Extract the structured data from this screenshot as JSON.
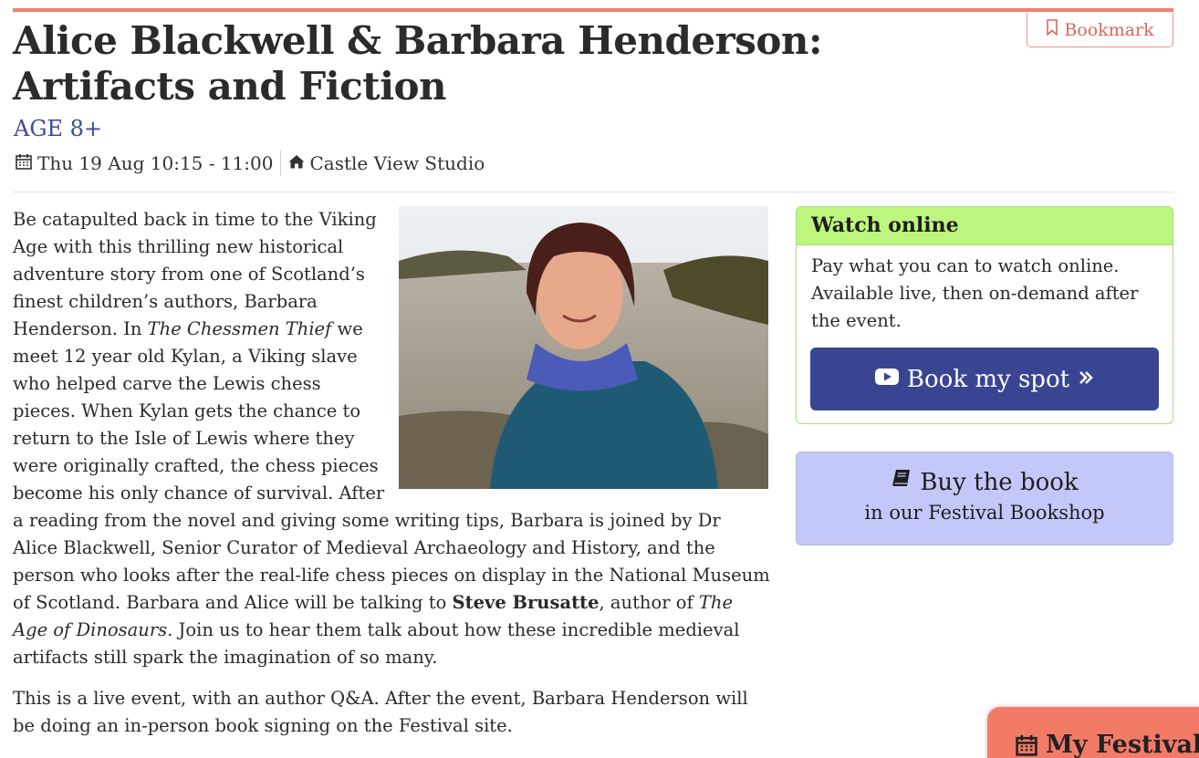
{
  "header": {
    "bookmark_label": "Bookmark",
    "title": "Alice Blackwell & Barbara Henderson: Artifacts and Fiction",
    "age": "AGE 8+",
    "date_time": "Thu 19 Aug 10:15 - 11:00",
    "venue": "Castle View Studio"
  },
  "description": {
    "p1_a": "Be catapulted back in time to the Viking Age with this thrilling new historical adventure story from one of Scotland’s finest children’s authors, Barbara Henderson. In ",
    "p1_book1": "The Chessmen Thief",
    "p1_b": " we meet 12 year old Kylan, a Viking slave who helped carve the Lewis chess pieces. When Kylan gets the chance to return to the Isle of Lewis where they were originally crafted, the chess pieces become his only chance of survival. After a reading from the novel and giving some writing tips, Barbara is joined by Dr Alice Blackwell, Senior Curator of Medieval Archaeology and History, and the person who looks after the real-life chess pieces on display in the National Museum of Scotland. Barbara and Alice will be talking to ",
    "p1_person": "Steve Brusatte",
    "p1_c": ", author of ",
    "p1_book2": "The Age of Dinosaurs",
    "p1_d": ". Join us to hear them talk about how these incredible medieval artifacts still spark the imagination of so many.",
    "p2": "This is a live event, with an author Q&A. After the event, Barbara Henderson will be doing an in-person book signing on the Festival site."
  },
  "watch_online": {
    "heading": "Watch online",
    "text": "Pay what you can to watch online. Available live, then on-demand after the event.",
    "button_label": "Book my spot"
  },
  "bookshop": {
    "title": "Buy the book",
    "subtitle": "in our Festival Bookshop"
  },
  "my_festival_label": "My Festival",
  "colors": {
    "accent": "#ef7f70",
    "age": "#3b4a9a",
    "book_button": "#394592",
    "watch_header": "#bdf57e",
    "buy_box": "#c4c8f9",
    "my_festival": "#f47a68"
  },
  "icons": {
    "bookmark": "bookmark-icon",
    "calendar": "calendar-icon",
    "venue": "home-icon",
    "play": "youtube-icon",
    "book": "book-icon",
    "chevron": "double-chevron-right-icon"
  }
}
